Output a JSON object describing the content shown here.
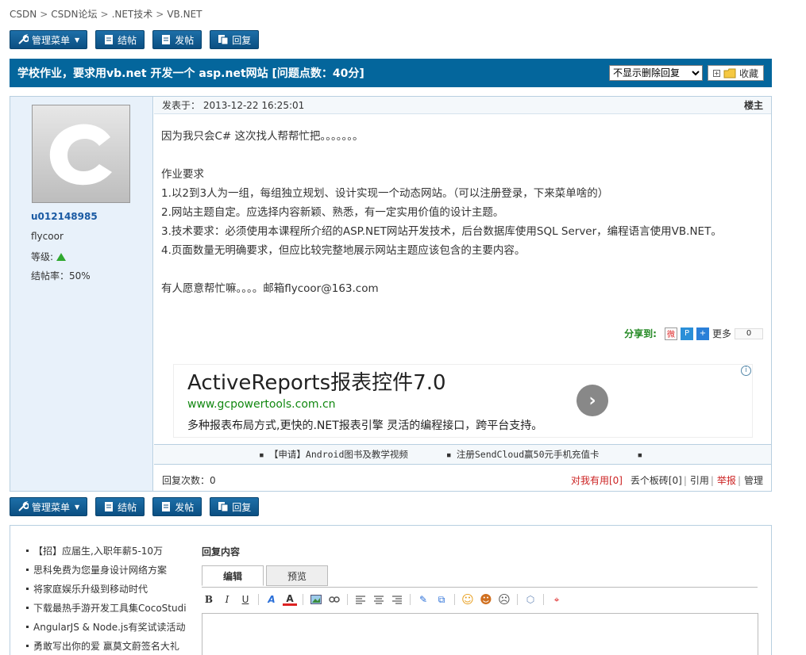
{
  "breadcrumb": [
    "CSDN",
    "CSDN论坛",
    ".NET技术",
    "VB.NET"
  ],
  "toolbar": {
    "manage": "管理菜单",
    "close": "结帖",
    "post": "发帖",
    "reply": "回复"
  },
  "thread": {
    "title": "学校作业，要求用vb.net 开发一个 asp.net网站 [问题点数：40分]",
    "filter_select": "不显示删除回复",
    "favorite": "收藏"
  },
  "author": {
    "username": "u012148985",
    "nickname": "flycoor",
    "level_label": "等级:",
    "close_rate": "结帖率：50%"
  },
  "post": {
    "posted_at": "发表于：  2013-12-22 16:25:01",
    "owner_tag": "楼主",
    "lines": [
      "因为我只会C# 这次找人帮帮忙把。。。。。。。",
      "",
      "作业要求",
      "1.以2到3人为一组，每组独立规划、设计实现一个动态网站。（可以注册登录，下来菜单啥的）",
      "2.网站主题自定。应选择内容新颖、熟悉，有一定实用价值的设计主题。",
      "3.技术要求：必须使用本课程所介绍的ASP.NET网站开发技术，后台数据库使用SQL Server，编程语言使用VB.NET。",
      "4.页面数量无明确要求，但应比较完整地展示网站主题应该包含的主要内容。",
      "",
      "有人愿意帮忙嘛。。。。邮箱flycoor@163.com"
    ],
    "share_label": "分享到:",
    "share_more": "更多",
    "share_count": "0",
    "reply_count": "回复次数：0",
    "useful": "对我有用[0]",
    "brick": "丢个板砖[0]",
    "quote": "引用",
    "report": "举报",
    "manage": "管理"
  },
  "ad": {
    "title": "ActiveReports报表控件7.0",
    "url": "www.gcpowertools.com.cn",
    "desc": "多种报表布局方式,更快的.NET报表引擎 灵活的编程接口，跨平台支持。"
  },
  "links": [
    "【申请】Android图书及教学视频",
    "注册SendCloud赢50元手机充值卡",
    ""
  ],
  "promo": [
    "【招】应届生,入职年薪5-10万",
    "思科免费为您量身设计网络方案",
    "将家庭娱乐升级到移动时代",
    "下载最热手游开发工具集CocoStudio",
    "AngularJS & Node.js有奖试读活动",
    "勇敢写出你的爱 赢莫文蔚签名大礼"
  ],
  "reply_form": {
    "label": "回复内容",
    "tab_edit": "编辑",
    "tab_preview": "预览"
  },
  "colors": {
    "title_bar": "#04669c",
    "button": "#0b4f82",
    "panel_bg": "#e8f1fa",
    "useful": "#cc2222",
    "share_label": "#228822"
  }
}
